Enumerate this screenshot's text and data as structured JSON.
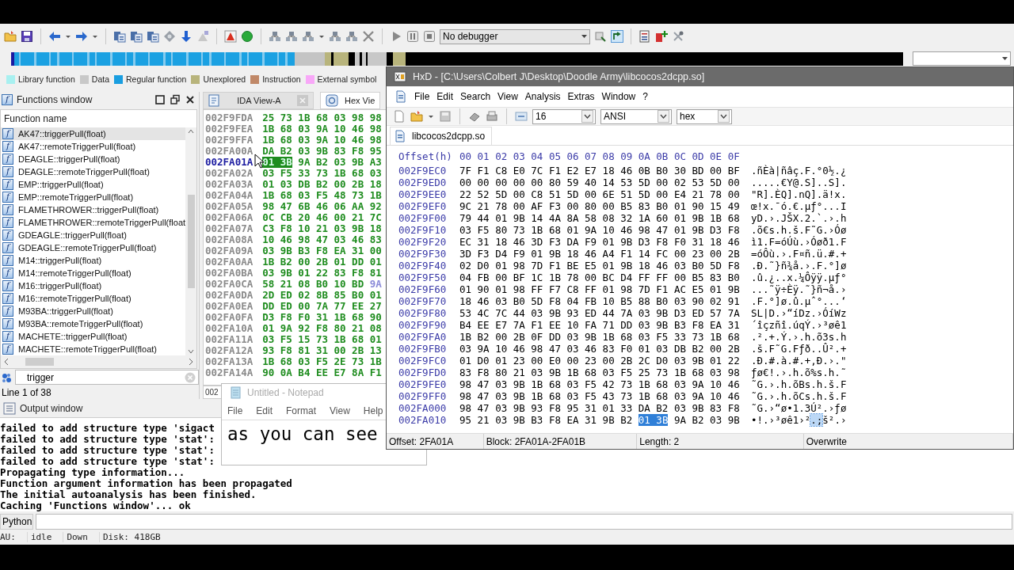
{
  "toolbar": {
    "debugger": "No debugger"
  },
  "legend": [
    {
      "label": "Library function",
      "color": "#a8f0f0"
    },
    {
      "label": "Data",
      "color": "#c8c8c8"
    },
    {
      "label": "Regular function",
      "color": "#1a9ee0"
    },
    {
      "label": "Unexplored",
      "color": "#b8b47c"
    },
    {
      "label": "Instruction",
      "color": "#c08868"
    },
    {
      "label": "External symbol",
      "color": "#f8a8f8"
    }
  ],
  "functions_window": {
    "title_icon": "f",
    "title": "Functions window",
    "column": "Function name",
    "items": [
      {
        "icon": "f",
        "name": "AK47::triggerPull(float)",
        "selected": true
      },
      {
        "icon": "f",
        "name": "AK47::remoteTriggerPull(float)",
        "selected": false
      },
      {
        "icon": "f",
        "name": "DEAGLE::triggerPull(float)",
        "selected": false
      },
      {
        "icon": "f",
        "name": "DEAGLE::remoteTriggerPull(float)",
        "selected": false
      },
      {
        "icon": "f",
        "name": "EMP::triggerPull(float)",
        "selected": false
      },
      {
        "icon": "f",
        "name": "EMP::remoteTriggerPull(float)",
        "selected": false
      },
      {
        "icon": "f",
        "name": "FLAMETHROWER::triggerPull(float)",
        "selected": false
      },
      {
        "icon": "f",
        "name": "FLAMETHROWER::remoteTriggerPull(float",
        "selected": false
      },
      {
        "icon": "f",
        "name": "GDEAGLE::triggerPull(float)",
        "selected": false
      },
      {
        "icon": "f",
        "name": "GDEAGLE::remoteTriggerPull(float)",
        "selected": false
      },
      {
        "icon": "f",
        "name": "M14::triggerPull(float)",
        "selected": false
      },
      {
        "icon": "f",
        "name": "M14::remoteTriggerPull(float)",
        "selected": false
      },
      {
        "icon": "f",
        "name": "M16::triggerPull(float)",
        "selected": false
      },
      {
        "icon": "f",
        "name": "M16::remoteTriggerPull(float)",
        "selected": false
      },
      {
        "icon": "f",
        "name": "M93BA::triggerPull(float)",
        "selected": false
      },
      {
        "icon": "f",
        "name": "M93BA::remoteTriggerPull(float)",
        "selected": false
      },
      {
        "icon": "f",
        "name": "MACHETE::triggerPull(float)",
        "selected": false
      },
      {
        "icon": "f",
        "name": "MACHETE::remoteTriggerPull(float)",
        "selected": false
      }
    ],
    "filter": "trigger",
    "status": "Line 1 of 38"
  },
  "ida_tabs": [
    {
      "label": "IDA View-A",
      "selected": false,
      "closable": true
    },
    {
      "label": "Hex Vie",
      "selected": true,
      "closable": false
    }
  ],
  "hex_view": {
    "rows": [
      {
        "address": "002F9FDA",
        "bytes": "25 73 1B 68 03 98 98",
        "current": false
      },
      {
        "address": "002F9FEA",
        "bytes": "1B 68 03 9A 10 46 98",
        "current": false
      },
      {
        "address": "002F9FFA",
        "bytes": "1B 68 03 9A 10 46 98",
        "current": false
      },
      {
        "address": "002FA00A",
        "bytes": "DA B2 03 9B 83 F8 95",
        "current": false
      },
      {
        "address": "002FA01A",
        "highlight": "01 3B",
        "bytes": "9A B2 03 9B A3",
        "current": true
      },
      {
        "address": "002FA02A",
        "bytes": "03 F5 33 73 1B 68 03",
        "current": false
      },
      {
        "address": "002FA03A",
        "bytes": "01 03 DB B2 00 2B 18",
        "current": false
      },
      {
        "address": "002FA04A",
        "bytes": "1B 68 03 F5 48 73 1B",
        "current": false
      },
      {
        "address": "002FA05A",
        "bytes": "98 47 6B 46 06 AA 92",
        "current": false
      },
      {
        "address": "002FA06A",
        "bytes": "0C CB 20 46 00 21 7C",
        "current": false
      },
      {
        "address": "002FA07A",
        "bytes": "C3 F8 10 21 03 9B 18",
        "current": false
      },
      {
        "address": "002FA08A",
        "bytes": "10 46 98 47 03 46 83",
        "current": false
      },
      {
        "address": "002FA09A",
        "bytes": "03 9B B3 F8 EA 31 00",
        "current": false
      },
      {
        "address": "002FA0AA",
        "bytes": "1B B2 00 2B 01 DD 01",
        "current": false
      },
      {
        "address": "002FA0BA",
        "bytes": "03 9B 01 22 83 F8 81",
        "current": false
      },
      {
        "address": "002FA0CA",
        "bytes": "58 21 08 B0 10 BD",
        "tail": "9A",
        "current": false
      },
      {
        "address": "002FA0DA",
        "bytes": "2D ED 02 8B 85 B0 01",
        "current": false
      },
      {
        "address": "002FA0EA",
        "bytes": "DD ED 00 7A 77 EE 27",
        "current": false
      },
      {
        "address": "002FA0FA",
        "bytes": "D3 F8 F0 31 1B 68 90",
        "current": false
      },
      {
        "address": "002FA10A",
        "bytes": "01 9A 92 F8 80 21 08",
        "current": false
      },
      {
        "address": "002FA11A",
        "bytes": "03 F5 15 73 1B 68 01",
        "current": false
      },
      {
        "address": "002FA12A",
        "bytes": "93 F8 81 31 00 2B 13",
        "current": false
      },
      {
        "address": "002FA13A",
        "bytes": "1B 68 03 F5 2E 73 1B",
        "current": false
      },
      {
        "address": "002FA14A",
        "bytes": "90 0A B4 EE E7 8A F1",
        "current": false
      }
    ],
    "status": "002"
  },
  "output_window": {
    "title": "Output window",
    "lines": [
      "failed to add structure type 'sigact",
      "failed to add structure type 'stat':",
      "failed to add structure type 'stat':",
      "failed to add structure type 'stat':",
      "Propagating type information...",
      "Function argument information has been propagated",
      "The initial autoanalysis has been finished.",
      "Caching 'Functions window'... ok"
    ]
  },
  "command_bar": {
    "language": "Python"
  },
  "status_bar": [
    "AU:",
    "idle",
    "Down",
    "Disk: 418GB"
  ],
  "hxd": {
    "title": "HxD - [C:\\Users\\Colbert J\\Desktop\\Doodle Army\\libcocos2dcpp.so]",
    "menu": [
      "File",
      "Edit",
      "Search",
      "View",
      "Analysis",
      "Extras",
      "Window",
      "?"
    ],
    "bytes_per_row": "16",
    "charset": "ANSI",
    "base": "hex",
    "tab": "libcocos2dcpp.so",
    "header": {
      "offset": "Offset(h)",
      "columns": "00 01 02 03 04 05 06 07 08 09 0A 0B 0C 0D 0E 0F"
    },
    "rows": [
      {
        "offset": "002F9EC0",
        "hex": "7F F1 C8 E0 7C F1 E2 E7 18 46 0B B0 30 BD 00 BF",
        "ascii": ".ñÈà|ñâç.F.°0½.¿"
      },
      {
        "offset": "002F9ED0",
        "hex": "00 00 00 00 00 80 59 40 14 53 5D 00 02 53 5D 00",
        "ascii": ".....€Y@.S]..S]."
      },
      {
        "offset": "002F9EE0",
        "hex": "22 52 5D 00 C8 51 5D 00 6E 51 5D 00 E4 21 78 00",
        "ascii": "\"R].ÈQ].nQ].ä!x."
      },
      {
        "offset": "002F9EF0",
        "hex": "9C 21 78 00 AF F3 00 80 00 B5 83 B0 01 90 15 49",
        "ascii": "œ!x.¯ó.€.µƒ°...I"
      },
      {
        "offset": "002F9F00",
        "hex": "79 44 01 9B 14 4A 8A 58 08 32 1A 60 01 9B 1B 68",
        "ascii": "yD.›.JŠX.2.`.›.h"
      },
      {
        "offset": "002F9F10",
        "hex": "03 F5 80 73 1B 68 01 9A 10 46 98 47 01 9B D3 F8",
        "ascii": ".õ€s.h.š.F˜G.›Óø"
      },
      {
        "offset": "002F9F20",
        "hex": "EC 31 18 46 3D F3 DA F9 01 9B D3 F8 F0 31 18 46",
        "ascii": "ì1.F=óÚù.›Óøð1.F"
      },
      {
        "offset": "002F9F30",
        "hex": "3D F3 D4 F9 01 9B 18 46 A4 F1 14 FC 00 23 00 2B",
        "ascii": "=óÔù.›.F¤ñ.ü.#.+"
      },
      {
        "offset": "002F9F40",
        "hex": "02 D0 01 98 7D F1 BE E5 01 9B 18 46 03 B0 5D F8",
        "ascii": ".Ð.˜}ñ¾å.›.F.°]ø"
      },
      {
        "offset": "002F9F50",
        "hex": "04 FB 00 BF 1C 1B 78 00 BC D4 FF FF 00 B5 83 B0",
        "ascii": ".û.¿..x.¼Ôÿÿ.µƒ°"
      },
      {
        "offset": "002F9F60",
        "hex": "01 90 01 98 FF F7 C8 FF 01 98 7D F1 AC E5 01 9B",
        "ascii": "...˜ÿ÷Èÿ.˜}ñ¬å.›"
      },
      {
        "offset": "002F9F70",
        "hex": "18 46 03 B0 5D F8 04 FB 10 B5 88 B0 03 90 02 91",
        "ascii": ".F.°]ø.û.µˆ°...‘"
      },
      {
        "offset": "002F9F80",
        "hex": "53 4C 7C 44 03 9B 93 ED 44 7A 03 9B D3 ED 57 7A",
        "ascii": "SL|D.›“íDz.›ÓíWz"
      },
      {
        "offset": "002F9F90",
        "hex": "B4 EE E7 7A F1 EE 10 FA 71 DD 03 9B B3 F8 EA 31",
        "ascii": "´îçzñî.úqÝ.›³øê1"
      },
      {
        "offset": "002F9FA0",
        "hex": "1B B2 00 2B 0F DD 03 9B 1B 68 03 F5 33 73 1B 68",
        "ascii": ".².+.Ý.›.h.õ3s.h"
      },
      {
        "offset": "002F9FB0",
        "hex": "03 9A 10 46 98 47 03 46 83 F0 01 03 DB B2 00 2B",
        "ascii": ".š.F˜G.Fƒð..Û².+"
      },
      {
        "offset": "002F9FC0",
        "hex": "01 D0 01 23 00 E0 00 23 00 2B 2C D0 03 9B 01 22",
        "ascii": ".Ð.#.à.#.+,Ð.›.\""
      },
      {
        "offset": "002F9FD0",
        "hex": "83 F8 80 21 03 9B 1B 68 03 F5 25 73 1B 68 03 98",
        "ascii": "ƒø€!.›.h.õ%s.h.˜"
      },
      {
        "offset": "002F9FE0",
        "hex": "98 47 03 9B 1B 68 03 F5 42 73 1B 68 03 9A 10 46",
        "ascii": "˜G.›.h.õBs.h.š.F"
      },
      {
        "offset": "002F9FF0",
        "hex": "98 47 03 9B 1B 68 03 F5 43 73 1B 68 03 9A 10 46",
        "ascii": "˜G.›.h.õCs.h.š.F"
      },
      {
        "offset": "002FA000",
        "hex": "98 47 03 9B 93 F8 95 31 01 33 DA B2 03 9B 83 F8",
        "ascii": "˜G.›“ø•1.3Ú².›ƒø"
      },
      {
        "offset": "002FA010",
        "hex": "95 21 03 9B B3 F8 EA 31 9B B2",
        "hex_selection": "01 3B",
        "hex_after": "9A B2 03 9B",
        "ascii": "•!.›³øê1›²",
        "ascii_selection": ".;",
        "ascii_after": "š².›"
      }
    ],
    "status": [
      "Offset: 2FA01A",
      "Block: 2FA01A-2FA01B",
      "Length: 2",
      "Overwrite"
    ]
  },
  "notepad": {
    "title": "Untitled - Notepad",
    "menu": [
      "File",
      "Edit",
      "Format",
      "View",
      "Help"
    ],
    "text": "as you can see"
  }
}
